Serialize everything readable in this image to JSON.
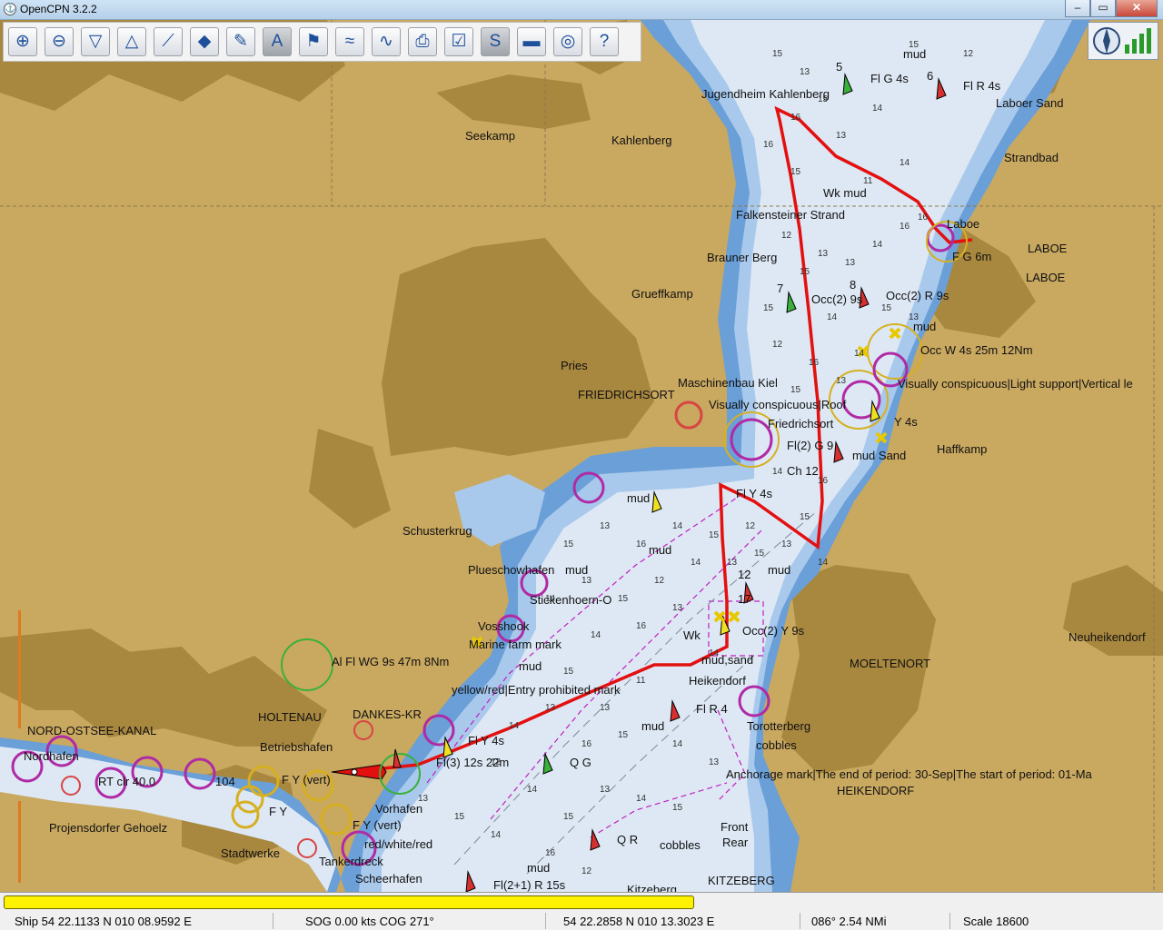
{
  "window": {
    "title": "OpenCPN 3.2.2",
    "app_icon": "opencpn-icon",
    "controls": [
      "minimize",
      "maximize",
      "close"
    ]
  },
  "toolbar": {
    "tools": [
      {
        "name": "zoom-in",
        "icon": "zoom-in-icon",
        "glyph": "⊕",
        "active": false
      },
      {
        "name": "zoom-out",
        "icon": "zoom-out-icon",
        "glyph": "⊖",
        "active": false
      },
      {
        "name": "smaller-scale-chart",
        "icon": "funnel-down-icon",
        "glyph": "▽",
        "active": false
      },
      {
        "name": "larger-scale-chart",
        "icon": "funnel-up-icon",
        "glyph": "△",
        "active": false
      },
      {
        "name": "create-route",
        "icon": "route-icon",
        "glyph": "⟋",
        "active": false
      },
      {
        "name": "auto-follow",
        "icon": "ship-icon",
        "glyph": "◆",
        "active": false
      },
      {
        "name": "options",
        "icon": "wrench-icon",
        "glyph": "✎",
        "active": false
      },
      {
        "name": "text-toggle",
        "icon": "text-icon",
        "glyph": "A",
        "active": true
      },
      {
        "name": "current-station",
        "icon": "current-icon",
        "glyph": "⚑",
        "active": false
      },
      {
        "name": "tides",
        "icon": "tide-icon",
        "glyph": "≈",
        "active": false
      },
      {
        "name": "tide-graph",
        "icon": "tide-graph-icon",
        "glyph": "∿",
        "active": false
      },
      {
        "name": "print-chart",
        "icon": "printer-icon",
        "glyph": "⎙",
        "active": false
      },
      {
        "name": "route-manager",
        "icon": "route-manager-icon",
        "glyph": "☑",
        "active": false
      },
      {
        "name": "enable-tracking",
        "icon": "track-icon",
        "glyph": "S",
        "active": true
      },
      {
        "name": "color-scheme",
        "icon": "color-scheme-icon",
        "glyph": "▬",
        "active": false
      },
      {
        "name": "man-overboard",
        "icon": "lifebuoy-icon",
        "glyph": "◎",
        "active": false
      },
      {
        "name": "help",
        "icon": "help-icon",
        "glyph": "?",
        "active": false
      }
    ]
  },
  "compass_widget": {
    "icons": [
      "compass-icon",
      "gps-signal-icon"
    ]
  },
  "chart": {
    "colors": {
      "land": "#c9a860",
      "land_dark": "#a8873f",
      "shallow": "#6a9fd8",
      "medium": "#a9c9ec",
      "deep": "#dde8f4",
      "route": "#e41010",
      "magenta": "#c21fc2"
    },
    "labels": {
      "seekamp": "Seekamp",
      "kahlenberg": "Kahlenberg",
      "jugendheim": "Jugendheim Kahlenberg",
      "fl_g_4s": "Fl G 4s",
      "fl_r_4s_top": "Fl R 4s",
      "laboer_sand": "Laboer Sand",
      "strandbad": "Strandbad",
      "wk_mud": "Wk    mud",
      "falkensteiner": "Falkensteiner Strand",
      "laboe_small": "Laboe",
      "laboe_a": "LABOE",
      "laboe_b": "LABOE",
      "fg6m": "F G 6m",
      "brauner_berg": "Brauner Berg",
      "grueffkamp": "Grueffkamp",
      "occ2_9s_a": "Occ(2)  9s",
      "occ2_9s_b": "Occ(2) R 9s",
      "mud_a": "mud",
      "occ_w": "Occ W 4s 25m 12Nm",
      "pries": "Pries",
      "friedrichsort_big": "FRIEDRICHSORT",
      "maschinenbau": "Maschinenbau Kiel",
      "conspicuous": "Visually conspicuous|Light support|Vertical le",
      "visually_rot": "Visually conspicuous|Roof",
      "friedrichsort_small": "Friedrichsort",
      "y4s": "Y 4s",
      "fl2": "Fl(2) G 9",
      "mud_sand_top": "mud Sand",
      "haffkamp": "Haffkamp",
      "ch12": "Ch 12",
      "fl_y_4s": "Fl Y 4s",
      "mud_b": "mud",
      "schusterkrug": "Schusterkrug",
      "mud_c": "mud",
      "plueschow": "Plueschowhafen",
      "mud_d": "mud",
      "mud_e": "mud",
      "stickenhoern": "Stickenhoern-O",
      "vosshook": "Vosshook",
      "wk_b": "Wk",
      "occ2_y9s": "Occ(2) Y 9s",
      "ocean_farm": "Marine farm mark",
      "mud_sand_b": "mud,sand",
      "al_fl": "Al Fl WG 9s 47m 8Nm",
      "mud_f": "mud",
      "moeltenort": "MOELTENORT",
      "neuheikendorf": "Neuheikendorf",
      "yellow_red": "yellow/red|Entry prohibited mark",
      "heikendorf_small": "Heikendorf",
      "holtenau": "HOLTENAU",
      "dankes": "DANKES-KR",
      "fl_r": "Fl R 4",
      "mud_g": "mud",
      "nok": "NORD-OSTSEE-KANAL",
      "betriebshafen": "Betriebshafen",
      "fl_y_4s_b": "Fl Y 4s",
      "torotterberg": "Torotterberg",
      "cobbles_a": "cobbles",
      "nordhafen": "Nordhafen",
      "fl3": "Fl(3) 12s 22m",
      "q_g": "Q G",
      "anchorage": "Anchorage mark|The end of period: 30-Sep|The start of period: 01-Ma",
      "heikendorf_big": "HEIKENDORF",
      "rt": "RT clr 40.0",
      "n104": "104",
      "f_y": "F Y (vert)",
      "f_y_b": "F Y",
      "vorhafen": "Vorhafen",
      "f_y_vert": "F Y (vert)",
      "projensdorfer": "Projensdorfer Gehoelz",
      "red_white": "red/white/red",
      "front": "Front",
      "rear": "Rear",
      "q_r": "Q R",
      "cobbles_b": "cobbles",
      "stadtwerke": "Stadtwerke",
      "tankerdreck": "Tankerdreck",
      "scheerhafen": "Scheerhafen",
      "mud_h": "mud",
      "fl21": "Fl(2+1) R 15s",
      "kitzeberg_small": "Kitzeberg",
      "kitzeberg_big": "KITZEBERG",
      "mud_i": "mud",
      "n5": "5",
      "n6": "6",
      "n7": "7",
      "n8": "8",
      "n12": "12",
      "n17": "17"
    },
    "soundings": [
      "15",
      "13",
      "15",
      "16",
      "15",
      "14",
      "12",
      "16",
      "13",
      "14",
      "15",
      "11",
      "16",
      "12",
      "13",
      "14",
      "16",
      "15",
      "13",
      "15",
      "14",
      "15",
      "12",
      "16",
      "14",
      "13",
      "15",
      "13",
      "14",
      "16",
      "15",
      "13",
      "14",
      "12",
      "15",
      "14",
      "16",
      "13",
      "15",
      "14",
      "13",
      "15",
      "12",
      "14",
      "13",
      "15",
      "14",
      "16",
      "13",
      "14",
      "15",
      "13",
      "11",
      "14",
      "13",
      "16",
      "15",
      "14",
      "13",
      "12",
      "14",
      "15",
      "13",
      "14",
      "15",
      "13",
      "15",
      "14",
      "16",
      "12"
    ]
  },
  "progress": {
    "value": 0.6
  },
  "status": {
    "ship": "Ship 54 22.1133 N   010 08.9592 E",
    "sog": "SOG 0.00 kts   COG 271°",
    "cursor": "54 22.2858 N   010 13.3023 E",
    "bearing": "086°   2.54 NMi",
    "scale": "Scale 18600"
  }
}
